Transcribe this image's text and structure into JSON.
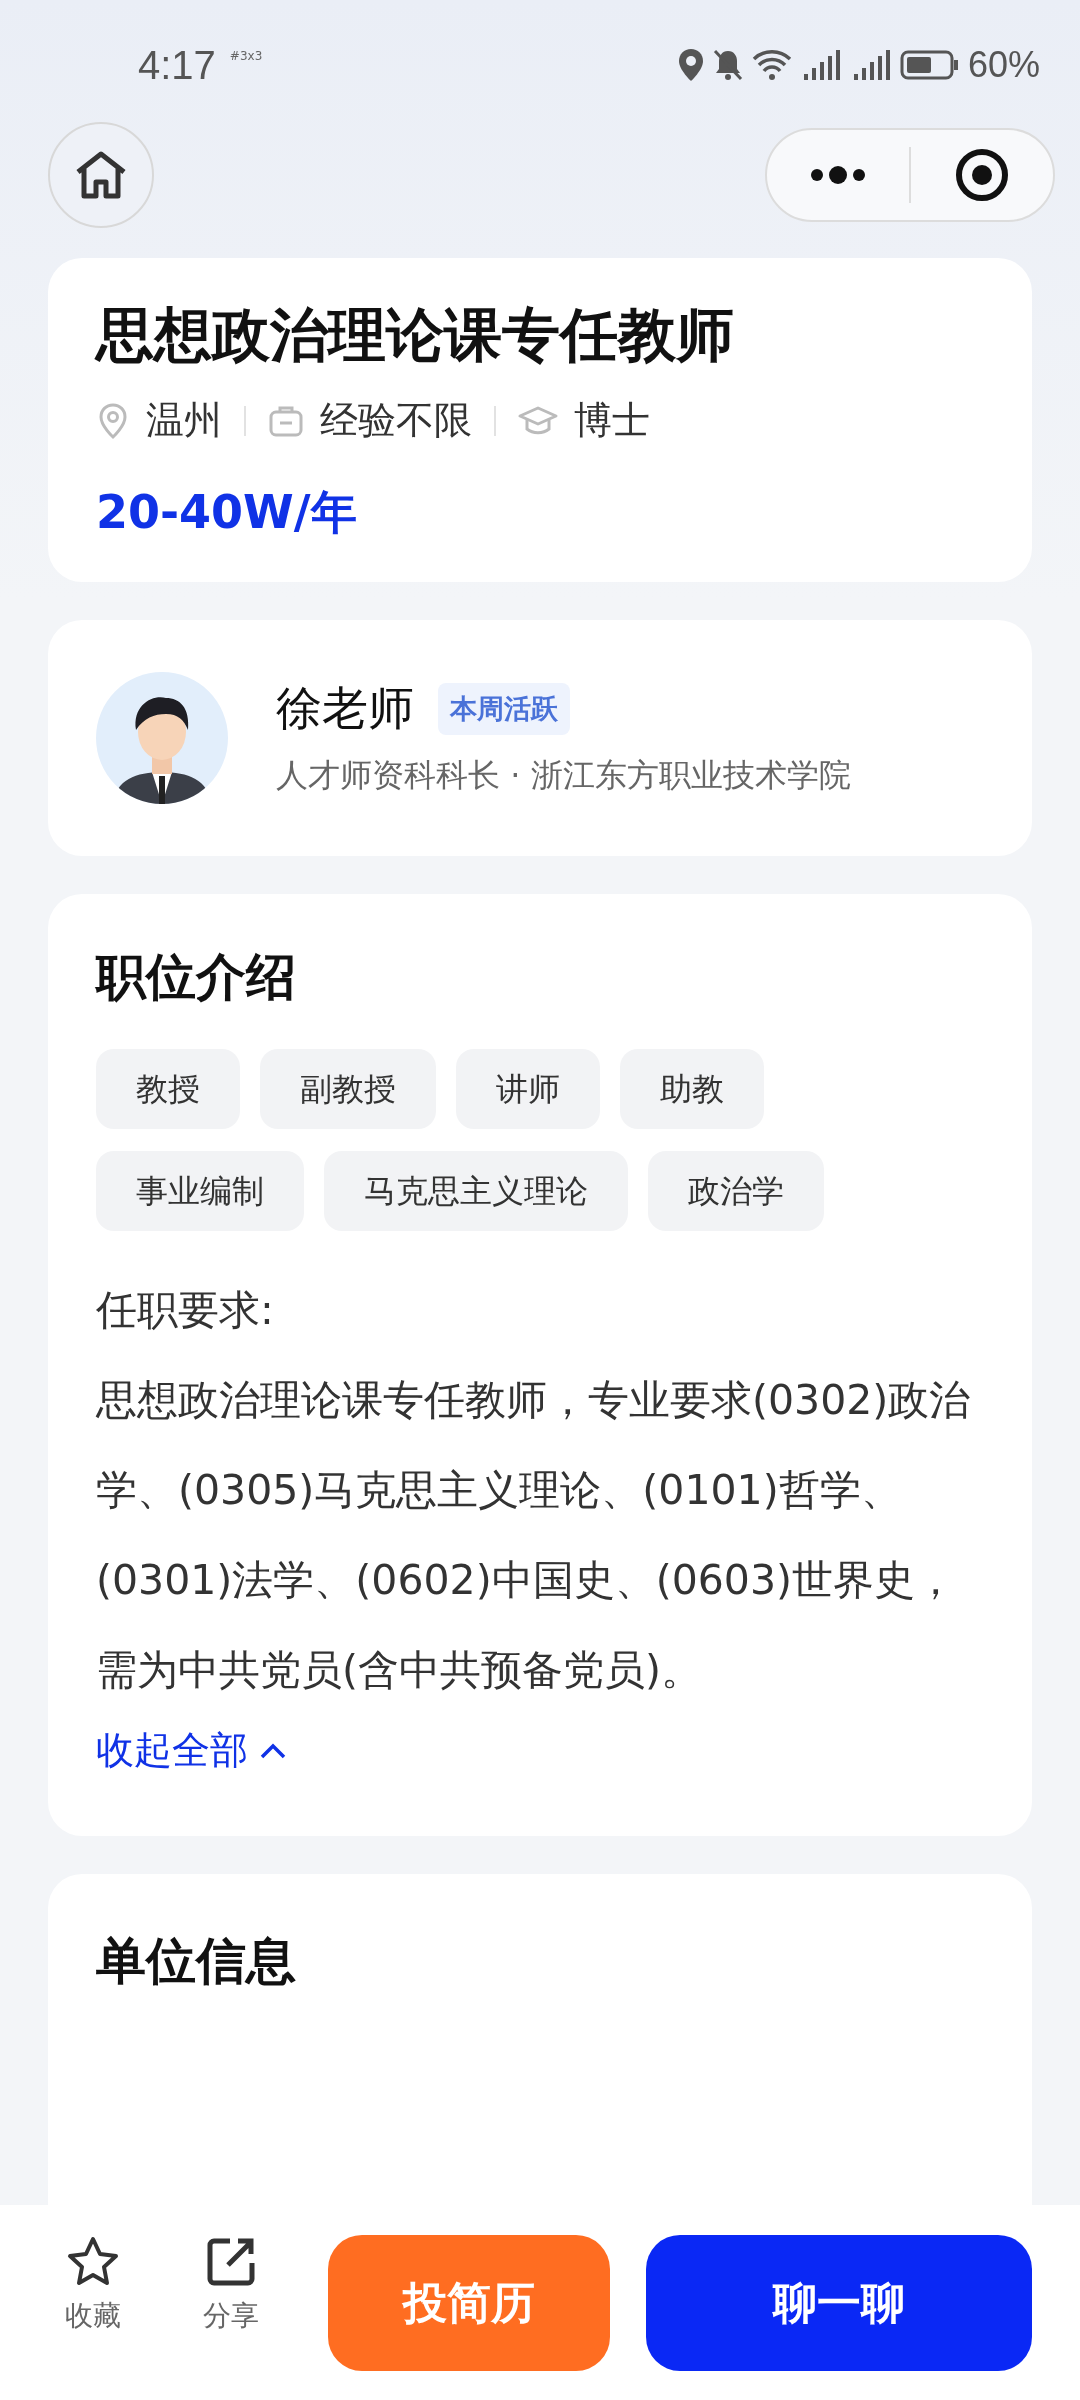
{
  "status_bar": {
    "time": "4:17",
    "note": "#3x3",
    "battery": "60%"
  },
  "job": {
    "title": "思想政治理论课专任教师",
    "meta": [
      {
        "kind": "location",
        "text": "温州"
      },
      {
        "kind": "experience",
        "text": "经验不限"
      },
      {
        "kind": "education",
        "text": "博士"
      }
    ],
    "salary": "20-40W/年"
  },
  "recruiter": {
    "name": "徐老师",
    "badge": "本周活跃",
    "subtitle": "人才师资科科长 · 浙江东方职业技术学院"
  },
  "description": {
    "heading": "职位介绍",
    "tags": [
      "教授",
      "副教授",
      "讲师",
      "助教",
      "事业编制",
      "马克思主义理论",
      "政治学"
    ],
    "requirements_label": "任职要求:",
    "requirements": "思想政治理论课专任教师，专业要求(0302)政治学、(0305)马克思主义理论、(0101)哲学、(0301)法学、(0602)中国史、(0603)世界史，需为中共党员(含中共预备党员)。",
    "toggle": "收起全部",
    "expanded": true
  },
  "organization": {
    "heading": "单位信息"
  },
  "bottom_bar": {
    "actions": [
      {
        "kind": "star",
        "label": "收藏"
      },
      {
        "kind": "share",
        "label": "分享"
      }
    ],
    "buttons": [
      {
        "kind": "primary",
        "label": "投简历"
      },
      {
        "kind": "secondary",
        "label": "聊一聊"
      }
    ]
  }
}
